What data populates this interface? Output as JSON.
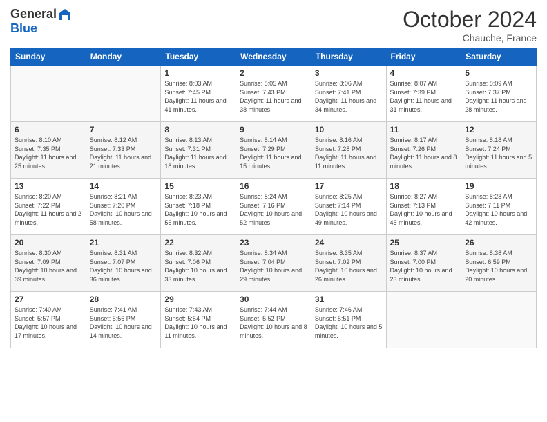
{
  "header": {
    "logo_general": "General",
    "logo_blue": "Blue",
    "month_title": "October 2024",
    "location": "Chauche, France"
  },
  "weekdays": [
    "Sunday",
    "Monday",
    "Tuesday",
    "Wednesday",
    "Thursday",
    "Friday",
    "Saturday"
  ],
  "weeks": [
    [
      {
        "day": "",
        "sunrise": "",
        "sunset": "",
        "daylight": ""
      },
      {
        "day": "",
        "sunrise": "",
        "sunset": "",
        "daylight": ""
      },
      {
        "day": "1",
        "sunrise": "Sunrise: 8:03 AM",
        "sunset": "Sunset: 7:45 PM",
        "daylight": "Daylight: 11 hours and 41 minutes."
      },
      {
        "day": "2",
        "sunrise": "Sunrise: 8:05 AM",
        "sunset": "Sunset: 7:43 PM",
        "daylight": "Daylight: 11 hours and 38 minutes."
      },
      {
        "day": "3",
        "sunrise": "Sunrise: 8:06 AM",
        "sunset": "Sunset: 7:41 PM",
        "daylight": "Daylight: 11 hours and 34 minutes."
      },
      {
        "day": "4",
        "sunrise": "Sunrise: 8:07 AM",
        "sunset": "Sunset: 7:39 PM",
        "daylight": "Daylight: 11 hours and 31 minutes."
      },
      {
        "day": "5",
        "sunrise": "Sunrise: 8:09 AM",
        "sunset": "Sunset: 7:37 PM",
        "daylight": "Daylight: 11 hours and 28 minutes."
      }
    ],
    [
      {
        "day": "6",
        "sunrise": "Sunrise: 8:10 AM",
        "sunset": "Sunset: 7:35 PM",
        "daylight": "Daylight: 11 hours and 25 minutes."
      },
      {
        "day": "7",
        "sunrise": "Sunrise: 8:12 AM",
        "sunset": "Sunset: 7:33 PM",
        "daylight": "Daylight: 11 hours and 21 minutes."
      },
      {
        "day": "8",
        "sunrise": "Sunrise: 8:13 AM",
        "sunset": "Sunset: 7:31 PM",
        "daylight": "Daylight: 11 hours and 18 minutes."
      },
      {
        "day": "9",
        "sunrise": "Sunrise: 8:14 AM",
        "sunset": "Sunset: 7:29 PM",
        "daylight": "Daylight: 11 hours and 15 minutes."
      },
      {
        "day": "10",
        "sunrise": "Sunrise: 8:16 AM",
        "sunset": "Sunset: 7:28 PM",
        "daylight": "Daylight: 11 hours and 11 minutes."
      },
      {
        "day": "11",
        "sunrise": "Sunrise: 8:17 AM",
        "sunset": "Sunset: 7:26 PM",
        "daylight": "Daylight: 11 hours and 8 minutes."
      },
      {
        "day": "12",
        "sunrise": "Sunrise: 8:18 AM",
        "sunset": "Sunset: 7:24 PM",
        "daylight": "Daylight: 11 hours and 5 minutes."
      }
    ],
    [
      {
        "day": "13",
        "sunrise": "Sunrise: 8:20 AM",
        "sunset": "Sunset: 7:22 PM",
        "daylight": "Daylight: 11 hours and 2 minutes."
      },
      {
        "day": "14",
        "sunrise": "Sunrise: 8:21 AM",
        "sunset": "Sunset: 7:20 PM",
        "daylight": "Daylight: 10 hours and 58 minutes."
      },
      {
        "day": "15",
        "sunrise": "Sunrise: 8:23 AM",
        "sunset": "Sunset: 7:18 PM",
        "daylight": "Daylight: 10 hours and 55 minutes."
      },
      {
        "day": "16",
        "sunrise": "Sunrise: 8:24 AM",
        "sunset": "Sunset: 7:16 PM",
        "daylight": "Daylight: 10 hours and 52 minutes."
      },
      {
        "day": "17",
        "sunrise": "Sunrise: 8:25 AM",
        "sunset": "Sunset: 7:14 PM",
        "daylight": "Daylight: 10 hours and 49 minutes."
      },
      {
        "day": "18",
        "sunrise": "Sunrise: 8:27 AM",
        "sunset": "Sunset: 7:13 PM",
        "daylight": "Daylight: 10 hours and 45 minutes."
      },
      {
        "day": "19",
        "sunrise": "Sunrise: 8:28 AM",
        "sunset": "Sunset: 7:11 PM",
        "daylight": "Daylight: 10 hours and 42 minutes."
      }
    ],
    [
      {
        "day": "20",
        "sunrise": "Sunrise: 8:30 AM",
        "sunset": "Sunset: 7:09 PM",
        "daylight": "Daylight: 10 hours and 39 minutes."
      },
      {
        "day": "21",
        "sunrise": "Sunrise: 8:31 AM",
        "sunset": "Sunset: 7:07 PM",
        "daylight": "Daylight: 10 hours and 36 minutes."
      },
      {
        "day": "22",
        "sunrise": "Sunrise: 8:32 AM",
        "sunset": "Sunset: 7:06 PM",
        "daylight": "Daylight: 10 hours and 33 minutes."
      },
      {
        "day": "23",
        "sunrise": "Sunrise: 8:34 AM",
        "sunset": "Sunset: 7:04 PM",
        "daylight": "Daylight: 10 hours and 29 minutes."
      },
      {
        "day": "24",
        "sunrise": "Sunrise: 8:35 AM",
        "sunset": "Sunset: 7:02 PM",
        "daylight": "Daylight: 10 hours and 26 minutes."
      },
      {
        "day": "25",
        "sunrise": "Sunrise: 8:37 AM",
        "sunset": "Sunset: 7:00 PM",
        "daylight": "Daylight: 10 hours and 23 minutes."
      },
      {
        "day": "26",
        "sunrise": "Sunrise: 8:38 AM",
        "sunset": "Sunset: 6:59 PM",
        "daylight": "Daylight: 10 hours and 20 minutes."
      }
    ],
    [
      {
        "day": "27",
        "sunrise": "Sunrise: 7:40 AM",
        "sunset": "Sunset: 5:57 PM",
        "daylight": "Daylight: 10 hours and 17 minutes."
      },
      {
        "day": "28",
        "sunrise": "Sunrise: 7:41 AM",
        "sunset": "Sunset: 5:56 PM",
        "daylight": "Daylight: 10 hours and 14 minutes."
      },
      {
        "day": "29",
        "sunrise": "Sunrise: 7:43 AM",
        "sunset": "Sunset: 5:54 PM",
        "daylight": "Daylight: 10 hours and 11 minutes."
      },
      {
        "day": "30",
        "sunrise": "Sunrise: 7:44 AM",
        "sunset": "Sunset: 5:52 PM",
        "daylight": "Daylight: 10 hours and 8 minutes."
      },
      {
        "day": "31",
        "sunrise": "Sunrise: 7:46 AM",
        "sunset": "Sunset: 5:51 PM",
        "daylight": "Daylight: 10 hours and 5 minutes."
      },
      {
        "day": "",
        "sunrise": "",
        "sunset": "",
        "daylight": ""
      },
      {
        "day": "",
        "sunrise": "",
        "sunset": "",
        "daylight": ""
      }
    ]
  ]
}
